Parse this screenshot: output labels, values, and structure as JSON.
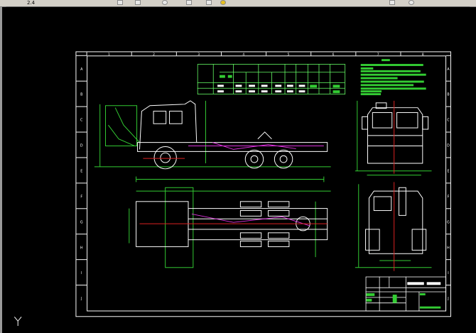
{
  "toolbar": {
    "left_text": "2.4",
    "icons": [
      "layer-icon",
      "print-icon",
      "separator",
      "view-icon",
      "pan-icon",
      "match-icon",
      "box-icon",
      "light-icon",
      "right-tool-icon",
      "right-view-icon"
    ]
  },
  "frame": {
    "row_labels": [
      "A",
      "B",
      "C",
      "D",
      "E",
      "F",
      "G",
      "H",
      "I",
      "J"
    ],
    "col_labels": [
      "1",
      "2",
      "3",
      "4",
      "5",
      "6",
      "7",
      "8"
    ]
  },
  "colors": {
    "background": "#000000",
    "outline": "#ffffff",
    "dimension": "#33dd33",
    "centerline": "#dd2222",
    "hidden": "#dd33dd",
    "toolbar": "#d4d0c8"
  },
  "ucs": {
    "label": "Y"
  }
}
